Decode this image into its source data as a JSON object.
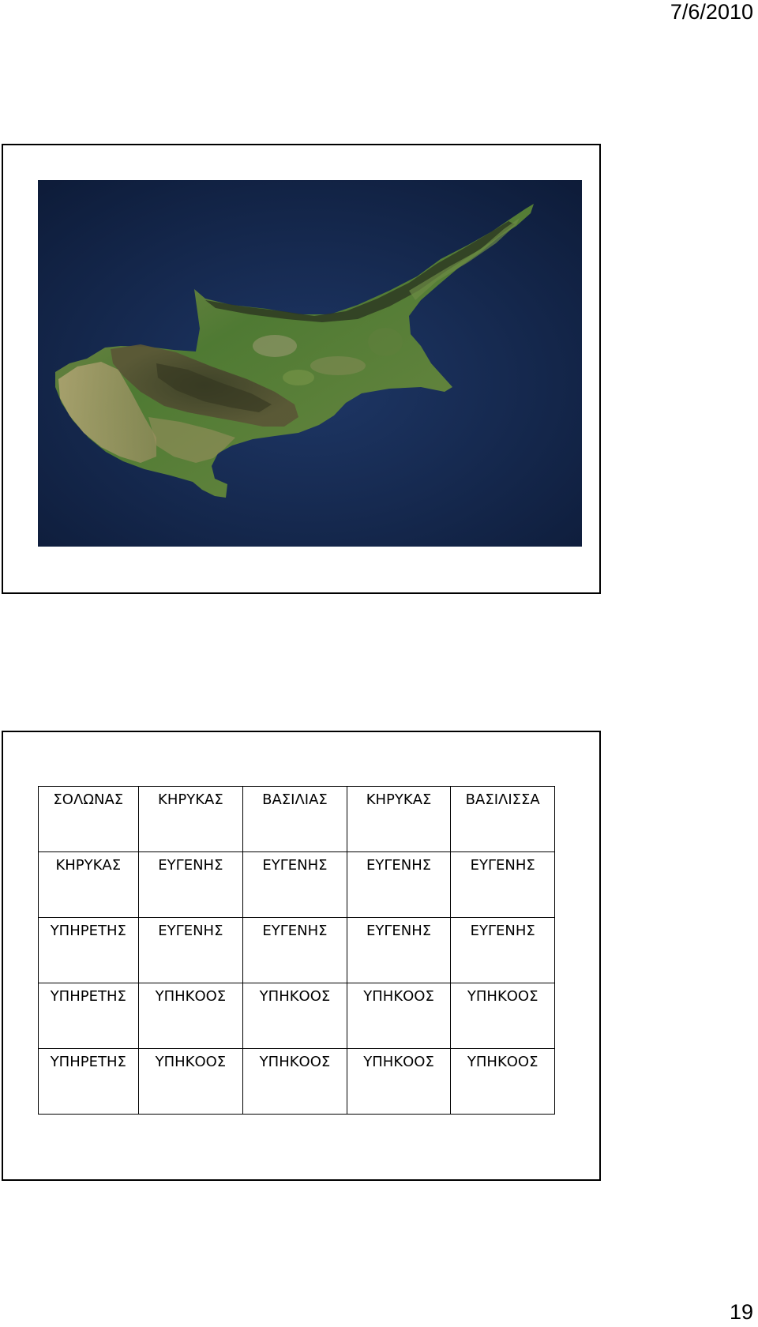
{
  "header": {
    "date": "7/6/2010"
  },
  "footer": {
    "page_number": "19"
  },
  "slide1": {
    "image_icon": "satellite-map-cyprus-icon"
  },
  "slide2": {
    "table": [
      [
        "ΣΟΛΩΝΑΣ",
        "ΚΗΡΥΚΑΣ",
        "ΒΑΣΙΛΙΑΣ",
        "ΚΗΡΥΚΑΣ",
        "ΒΑΣΙΛΙΣΣΑ"
      ],
      [
        "ΚΗΡΥΚΑΣ",
        "ΕΥΓΕΝΗΣ",
        "ΕΥΓΕΝΗΣ",
        "ΕΥΓΕΝΗΣ",
        "ΕΥΓΕΝΗΣ"
      ],
      [
        "ΥΠΗΡΕΤΗΣ",
        "ΕΥΓΕΝΗΣ",
        "ΕΥΓΕΝΗΣ",
        "ΕΥΓΕΝΗΣ",
        "ΕΥΓΕΝΗΣ"
      ],
      [
        "ΥΠΗΡΕΤΗΣ",
        "ΥΠΗΚΟΟΣ",
        "ΥΠΗΚΟΟΣ",
        "ΥΠΗΚΟΟΣ",
        "ΥΠΗΚΟΟΣ"
      ],
      [
        "ΥΠΗΡΕΤΗΣ",
        "ΥΠΗΚΟΟΣ",
        "ΥΠΗΚΟΟΣ",
        "ΥΠΗΚΟΟΣ",
        "ΥΠΗΚΟΟΣ"
      ]
    ]
  },
  "colors": {
    "sea_dark": "#0f1f3e",
    "sea_light": "#1e3766",
    "land_green": "#3f6a2c",
    "mountain_brown": "#4e4a31",
    "land_tan": "#a99a6a",
    "border": "#000000"
  }
}
